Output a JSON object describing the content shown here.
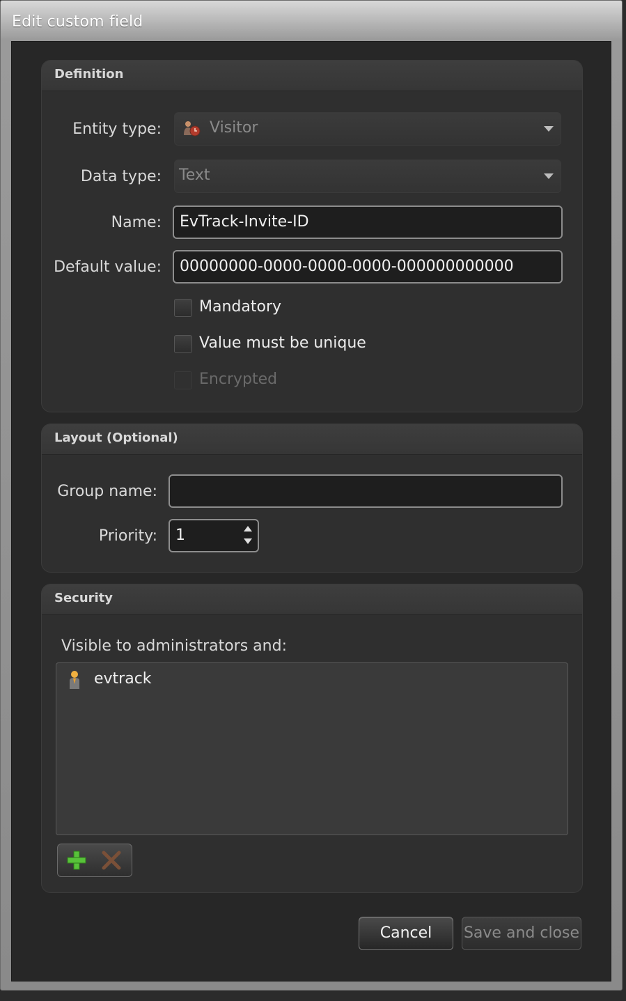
{
  "window": {
    "title": "Edit custom field"
  },
  "definition": {
    "header": "Definition",
    "entity_type": {
      "label": "Entity type:",
      "value": "Visitor",
      "icon": "visitor-icon"
    },
    "data_type": {
      "label": "Data type:",
      "value": "Text"
    },
    "name": {
      "label": "Name:",
      "value": "EvTrack-Invite-ID"
    },
    "default_value": {
      "label": "Default value:",
      "value": "00000000-0000-0000-0000-000000000000"
    },
    "checkboxes": [
      {
        "label": "Mandatory",
        "checked": false,
        "enabled": true
      },
      {
        "label": "Value must be unique",
        "checked": false,
        "enabled": true
      },
      {
        "label": "Encrypted",
        "checked": false,
        "enabled": false
      }
    ]
  },
  "layout": {
    "header": "Layout (Optional)",
    "group_name": {
      "label": "Group name:",
      "value": ""
    },
    "priority": {
      "label": "Priority:",
      "value": "1"
    }
  },
  "security": {
    "header": "Security",
    "visible_label": "Visible to administrators and:",
    "users": [
      {
        "name": "evtrack",
        "icon": "user-icon"
      }
    ],
    "toolbar": {
      "add_icon": "plus-icon",
      "remove_icon": "x-icon"
    }
  },
  "footer": {
    "cancel_label": "Cancel",
    "save_label": "Save and close"
  },
  "colors": {
    "add_green": "#58c23a",
    "remove_brown": "#7a5038",
    "user_orange": "#e8a030"
  }
}
